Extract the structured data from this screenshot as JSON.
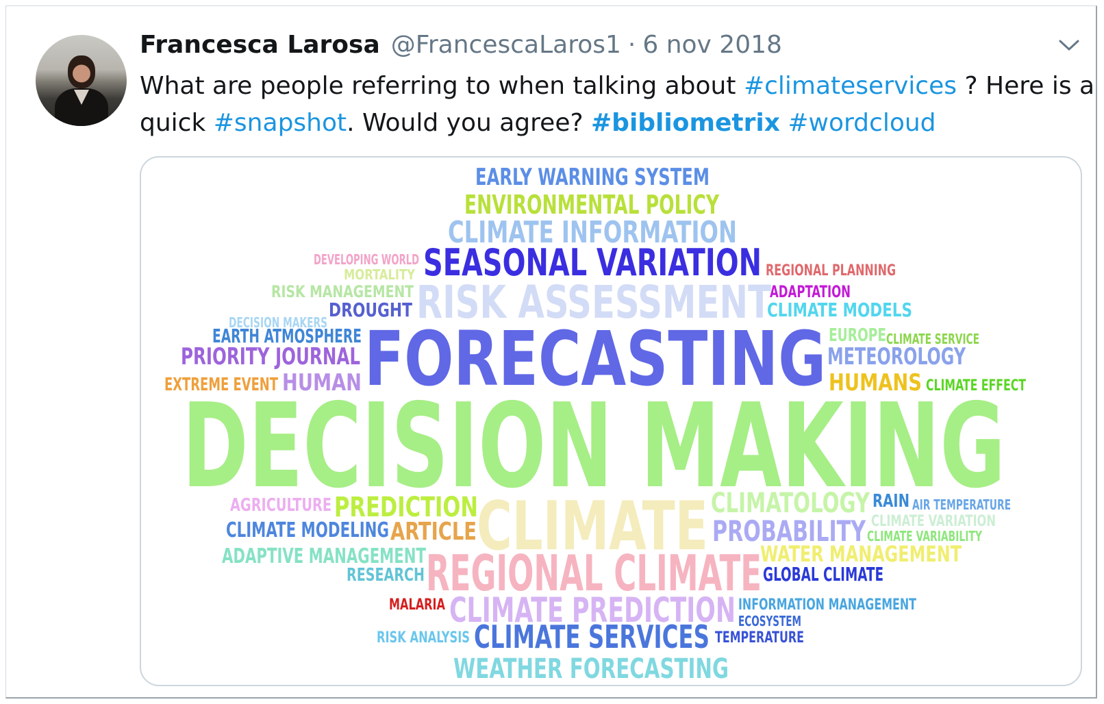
{
  "tweet": {
    "author_name": "Francesca Larosa",
    "author_handle": "@FrancescaLaros1",
    "separator": "·",
    "date": "6 nov 2018",
    "text": {
      "line1_a": "What are people referring to when talking about ",
      "hashtag_climateservices": "#climateservices",
      "line1_b": " ? Here is a",
      "line2_a": "quick ",
      "hashtag_snapshot": "#snapshot",
      "line2_b": ". Would you agree? ",
      "hashtag_bibliometrix": "#bibliometrix",
      "line2_c": " ",
      "hashtag_wordcloud": "#wordcloud"
    }
  },
  "icons": {
    "menu": "chevron-down-icon"
  },
  "colors": {
    "hashtag": "#1b95e0",
    "text": "#14171a",
    "secondary": "#657786"
  },
  "wordcloud": {
    "words": [
      {
        "text": "EARLY WARNING SYSTEM",
        "color": "#5b8ee6"
      },
      {
        "text": "ENVIRONMENTAL POLICY",
        "color": "#b8e03a"
      },
      {
        "text": "CLIMATE INFORMATION",
        "color": "#9ec3ef"
      },
      {
        "text": "SEASONAL VARIATION",
        "color": "#3a2ee0"
      },
      {
        "text": "DEVELOPING WORLD",
        "color": "#f3a3c8"
      },
      {
        "text": "MORTALITY",
        "color": "#d7ec9a"
      },
      {
        "text": "REGIONAL PLANNING",
        "color": "#e0686c"
      },
      {
        "text": "RISK MANAGEMENT",
        "color": "#b6e6a4"
      },
      {
        "text": "RISK ASSESSMENT",
        "color": "#d3dcf6"
      },
      {
        "text": "ADAPTATION",
        "color": "#c21ad6"
      },
      {
        "text": "DROUGHT",
        "color": "#5660cf"
      },
      {
        "text": "CLIMATE MODELS",
        "color": "#52d6ee"
      },
      {
        "text": "DECISION MAKERS",
        "color": "#a8d6f4"
      },
      {
        "text": "EARTH ATMOSPHERE",
        "color": "#3f86d6"
      },
      {
        "text": "FORECASTING",
        "color": "#6068e6"
      },
      {
        "text": "EUROPE",
        "color": "#a6ee9a"
      },
      {
        "text": "CLIMATE SERVICE",
        "color": "#8cd64c"
      },
      {
        "text": "PRIORITY JOURNAL",
        "color": "#9d64dc"
      },
      {
        "text": "METEOROLOGY",
        "color": "#8aa2ec"
      },
      {
        "text": "EXTREME EVENT",
        "color": "#eea03c"
      },
      {
        "text": "HUMAN",
        "color": "#b78ee6"
      },
      {
        "text": "HUMANS",
        "color": "#eec21e"
      },
      {
        "text": "CLIMATE EFFECT",
        "color": "#5ad624"
      },
      {
        "text": "DECISION MAKING",
        "color": "#a6ee86"
      },
      {
        "text": "AGRICULTURE",
        "color": "#ecaef0"
      },
      {
        "text": "PREDICTION",
        "color": "#bcee40"
      },
      {
        "text": "CLIMATE",
        "color": "#f4ecbc"
      },
      {
        "text": "CLIMATOLOGY",
        "color": "#c6f4a8"
      },
      {
        "text": "RAIN",
        "color": "#3a8ad6"
      },
      {
        "text": "AIR TEMPERATURE",
        "color": "#68a6e6"
      },
      {
        "text": "CLIMATE VARIATION",
        "color": "#cceed4"
      },
      {
        "text": "CLIMATE MODELING",
        "color": "#4e86de"
      },
      {
        "text": "ARTICLE",
        "color": "#e6a44c"
      },
      {
        "text": "PROBABILITY",
        "color": "#aaaaf4"
      },
      {
        "text": "CLIMATE VARIABILITY",
        "color": "#8ee67c"
      },
      {
        "text": "ADAPTIVE MANAGEMENT",
        "color": "#86e2c4"
      },
      {
        "text": "WATER MANAGEMENT",
        "color": "#f0ee70"
      },
      {
        "text": "RESEARCH",
        "color": "#62c4d6"
      },
      {
        "text": "REGIONAL CLIMATE",
        "color": "#f6b4c0"
      },
      {
        "text": "GLOBAL CLIMATE",
        "color": "#2a3ad6"
      },
      {
        "text": "MALARIA",
        "color": "#d61e1e"
      },
      {
        "text": "CLIMATE PREDICTION",
        "color": "#d6b4f4"
      },
      {
        "text": "INFORMATION MANAGEMENT",
        "color": "#48a6e0"
      },
      {
        "text": "ECOSYSTEM",
        "color": "#3a6ad6"
      },
      {
        "text": "RISK ANALYSIS",
        "color": "#6ac6ec"
      },
      {
        "text": "CLIMATE SERVICES",
        "color": "#4a76dc"
      },
      {
        "text": "TEMPERATURE",
        "color": "#3852d6"
      },
      {
        "text": "WEATHER FORECASTING",
        "color": "#80d8e0"
      }
    ]
  }
}
